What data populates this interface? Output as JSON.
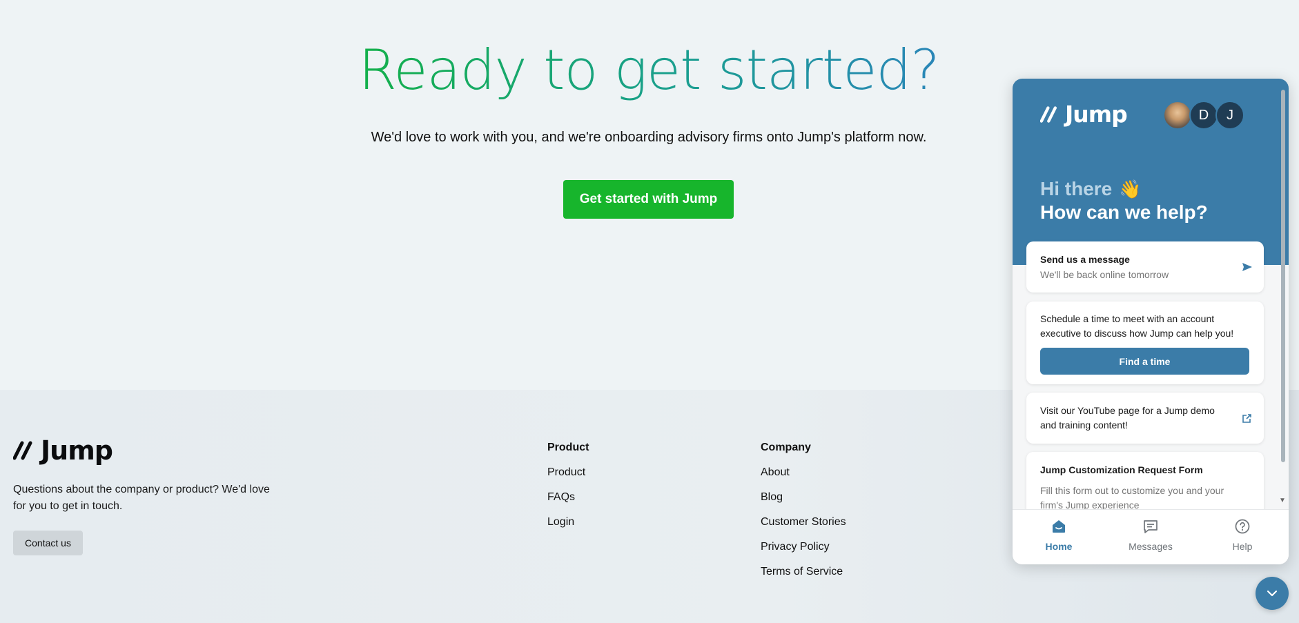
{
  "hero": {
    "title": "Ready to get started?",
    "subtitle": "We'd love to work with you, and we're onboarding advisory firms onto Jump's platform now.",
    "cta_label": "Get started with Jump"
  },
  "brand": {
    "name": "Jump",
    "colors": {
      "green": "#17b52c",
      "blue": "#3b7ca8"
    }
  },
  "footer": {
    "description": "Questions about the company or product? We'd love for you to get in touch.",
    "contact_label": "Contact us",
    "product": {
      "heading": "Product",
      "links": [
        "Product",
        "FAQs",
        "Login"
      ]
    },
    "company": {
      "heading": "Company",
      "links": [
        "About",
        "Blog",
        "Customer Stories",
        "Privacy Policy",
        "Terms of Service"
      ]
    }
  },
  "chat": {
    "brand": "Jump",
    "avatars": [
      {
        "type": "photo",
        "letter": ""
      },
      {
        "type": "letter",
        "letter": "D"
      },
      {
        "type": "letter",
        "letter": "J"
      }
    ],
    "greeting_line1": "Hi there",
    "greeting_emoji": "👋",
    "greeting_line2": "How can we help?",
    "send": {
      "title": "Send us a message",
      "subtitle": "We'll be back online tomorrow",
      "icon": "send-icon"
    },
    "schedule": {
      "text": "Schedule a time to meet with an account executive to discuss how Jump can help you!",
      "button_label": "Find a time"
    },
    "youtube": {
      "text": "Visit our YouTube page for a Jump demo and training content!",
      "icon": "external-link-icon"
    },
    "form": {
      "title": "Jump Customization Request Form",
      "text": "Fill this form out to customize you and your firm's Jump experience"
    },
    "nav": {
      "home": "Home",
      "messages": "Messages",
      "help": "Help"
    }
  }
}
